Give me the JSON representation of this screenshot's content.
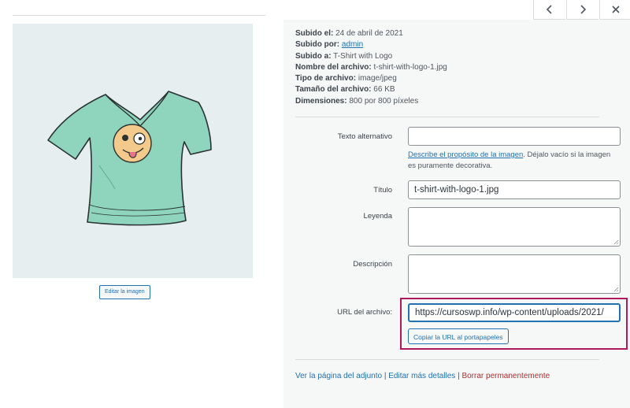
{
  "nav": {
    "prev_icon": "chevron-left-icon",
    "next_icon": "chevron-right-icon",
    "close_icon": "close-icon"
  },
  "preview": {
    "image_desc": "teal t-shirt with winking emoji logo",
    "edit_button_label": "Editar la imagen"
  },
  "details": {
    "uploaded_on_label": "Subido el:",
    "uploaded_on_value": "24 de abril de 2021",
    "uploaded_by_label": "Subido por:",
    "uploaded_by_value": "admin",
    "uploaded_to_label": "Subido a:",
    "uploaded_to_value": "T-Shirt with Logo",
    "file_name_label": "Nombre del archivo:",
    "file_name_value": "t-shirt-with-logo-1.jpg",
    "file_type_label": "Tipo de archivo:",
    "file_type_value": "image/jpeg",
    "file_size_label": "Tamaño del archivo:",
    "file_size_value": "66 KB",
    "dimensions_label": "Dimensiones:",
    "dimensions_value": "800 por 800 píxeles"
  },
  "form": {
    "alt_label": "Texto alternativo",
    "alt_value": "",
    "alt_help_link": "Describe el propósito de la imagen",
    "alt_help_text": ". Déjalo vacío si la imagen es puramente decorativa.",
    "title_label": "Título",
    "title_value": "t-shirt-with-logo-1.jpg",
    "caption_label": "Leyenda",
    "caption_value": "",
    "description_label": "Descripción",
    "description_value": "",
    "url_label": "URL del archivo:",
    "url_value": "https://cursoswp.info/wp-content/uploads/2021/",
    "copy_button_label": "Copiar la URL al portapapeles"
  },
  "actions": {
    "view_attachment": "Ver la página del adjunto",
    "separator": " | ",
    "edit_details": "Editar más detalles",
    "delete_permanently": "Borrar permanentemente"
  },
  "colors": {
    "link": "#2271b1",
    "danger": "#b32d2e",
    "highlight": "#b0195a",
    "shirt": "#8fd4bd"
  }
}
